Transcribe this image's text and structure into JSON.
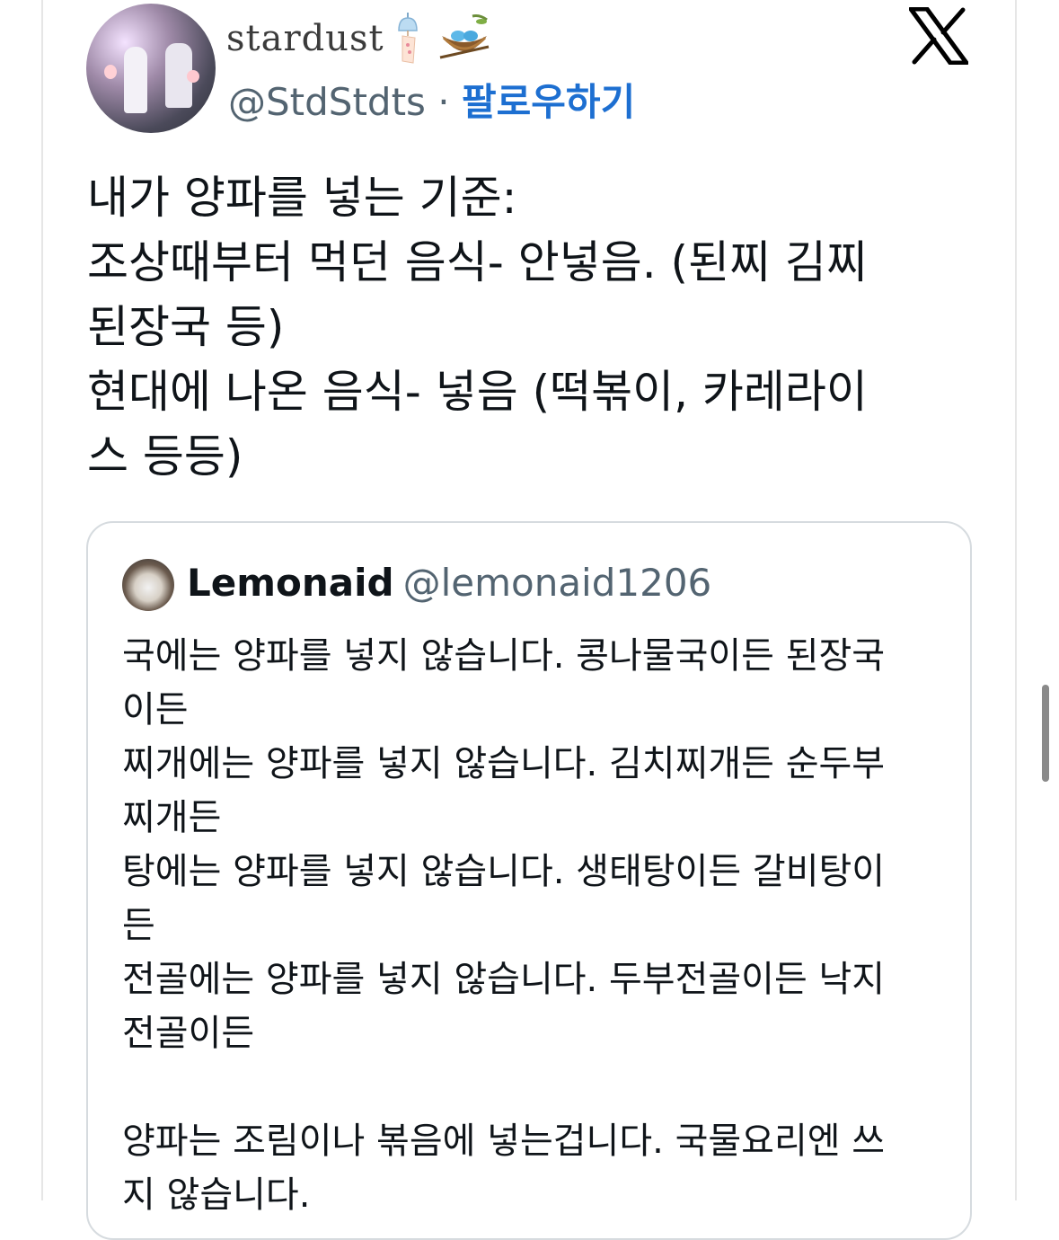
{
  "author": {
    "display_name": "stardust",
    "handle": "@StdStdts",
    "separator": "·",
    "follow_label": "팔로우하기",
    "name_icons": [
      "wind-chime-icon",
      "nest-with-eggs-icon"
    ]
  },
  "platform_icon": "x-logo-icon",
  "tweet": {
    "lines": [
      "내가 양파를 넣는 기준:",
      "조상때부터 먹던 음식- 안넣음. (된찌 김찌",
      "된장국 등)",
      "현대에 나온 음식- 넣음 (떡볶이, 카레라이",
      "스 등등)"
    ]
  },
  "quoted_tweet": {
    "display_name": "Lemonaid",
    "handle": "@lemonaid1206",
    "lines": [
      "국에는 양파를 넣지 않습니다. 콩나물국이든 된장국",
      "이든",
      "찌개에는 양파를 넣지 않습니다. 김치찌개든 순두부",
      "찌개든",
      "탕에는 양파를 넣지 않습니다. 생태탕이든 갈비탕이",
      "든",
      "전골에는 양파를 넣지 않습니다. 두부전골이든 낙지",
      "전골이든",
      "",
      "양파는 조림이나 볶음에 넣는겁니다. 국물요리엔 쓰",
      "지 않습니다."
    ]
  },
  "colors": {
    "text": "#0f1419",
    "secondary": "#536471",
    "follow": "#1d6fd1",
    "border": "#d6dbdf"
  }
}
